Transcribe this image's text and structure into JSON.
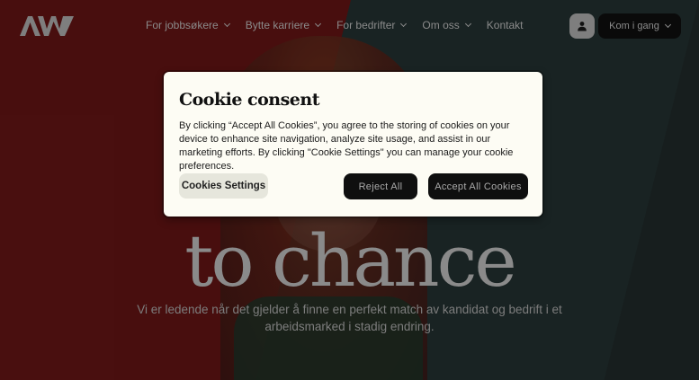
{
  "nav": {
    "logo_text": "AW",
    "links": [
      {
        "label": "For jobbsøkere"
      },
      {
        "label": "Bytte karriere"
      },
      {
        "label": "For bedrifter"
      },
      {
        "label": "Om oss"
      },
      {
        "label": "Kontakt"
      }
    ],
    "cta_label": "Kom i gang"
  },
  "hero": {
    "headline": "to chance",
    "subtitle": "Vi er ledende når det gjelder å finne en perfekt match av kandidat og bedrift i et arbeidsmarked i stadig endring."
  },
  "cookie": {
    "title": "Cookie consent",
    "body": "By clicking “Accept All Cookies”, you agree to the storing of cookies on your device to enhance site navigation, analyze site usage, and assist in our marketing efforts. By clicking \"Cookie Settings\" you can manage your cookie preferences.",
    "settings_label": "Cookies Settings",
    "reject_label": "Reject All",
    "accept_label": "Accept All Cookies"
  },
  "colors": {
    "hero_red": "#6b1212",
    "hero_teal": "#233232",
    "modal_bg": "#fdfcf4",
    "button_dark": "#0f0f0f"
  }
}
